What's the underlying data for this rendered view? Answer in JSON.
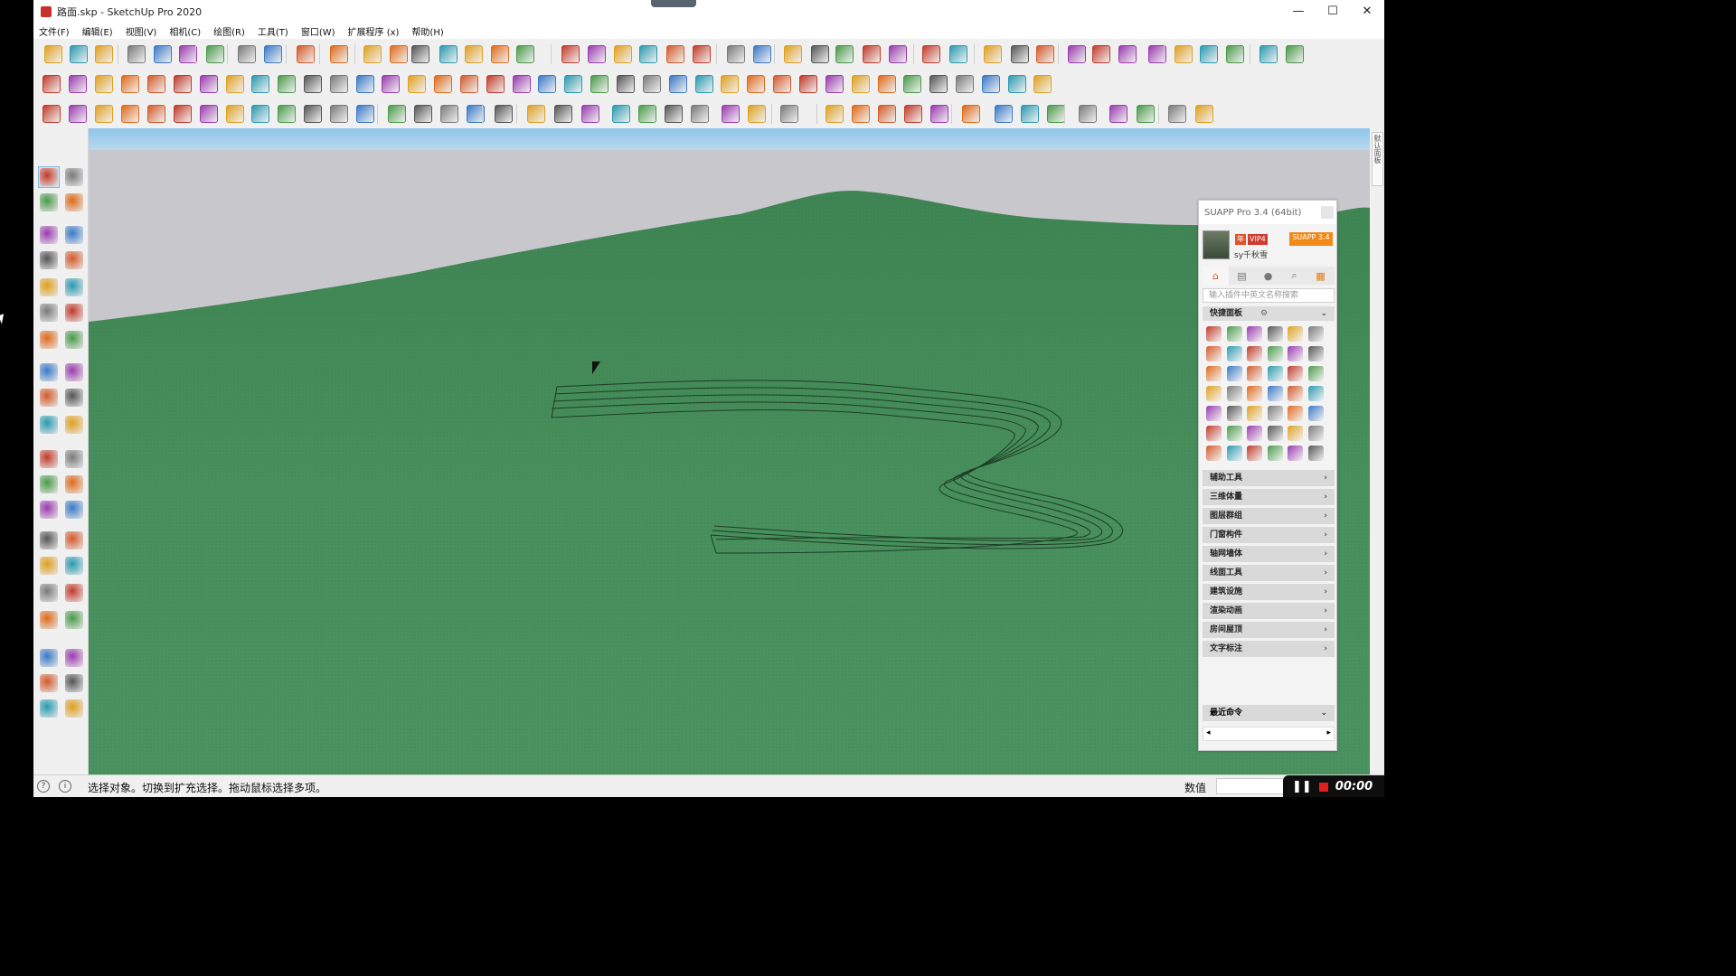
{
  "window": {
    "title": "路面.skp - SketchUp Pro 2020",
    "minimize": "—",
    "maximize": "☐",
    "close": "✕"
  },
  "menu": [
    "文件(F)",
    "编辑(E)",
    "视图(V)",
    "相机(C)",
    "绘图(R)",
    "工具(T)",
    "窗口(W)",
    "扩展程序 (x)",
    "帮助(H)"
  ],
  "suapp": {
    "title": "SUAPP Pro 3.4 (64bit)",
    "badge_year": "年",
    "badge_vip": "VIP4",
    "badge_brand": "SUAPP 3.4",
    "username": "sy千秋雪",
    "search_placeholder": "输入插件中英文名称搜索",
    "quick_panel": "快捷面板",
    "categories": [
      "辅助工具",
      "三维体量",
      "图层群组",
      "门窗构件",
      "轴网墙体",
      "线面工具",
      "建筑设施",
      "渲染动画",
      "房间屋顶",
      "文字标注"
    ],
    "recent": "最近命令",
    "chevron": "›",
    "expand": "⌄"
  },
  "tray": {
    "tab_label": "默认面板"
  },
  "status": {
    "hint": "选择对象。切换到扩充选择。拖动鼠标选择多项。",
    "vcb_label": "数值",
    "recording_time": "00:00"
  }
}
